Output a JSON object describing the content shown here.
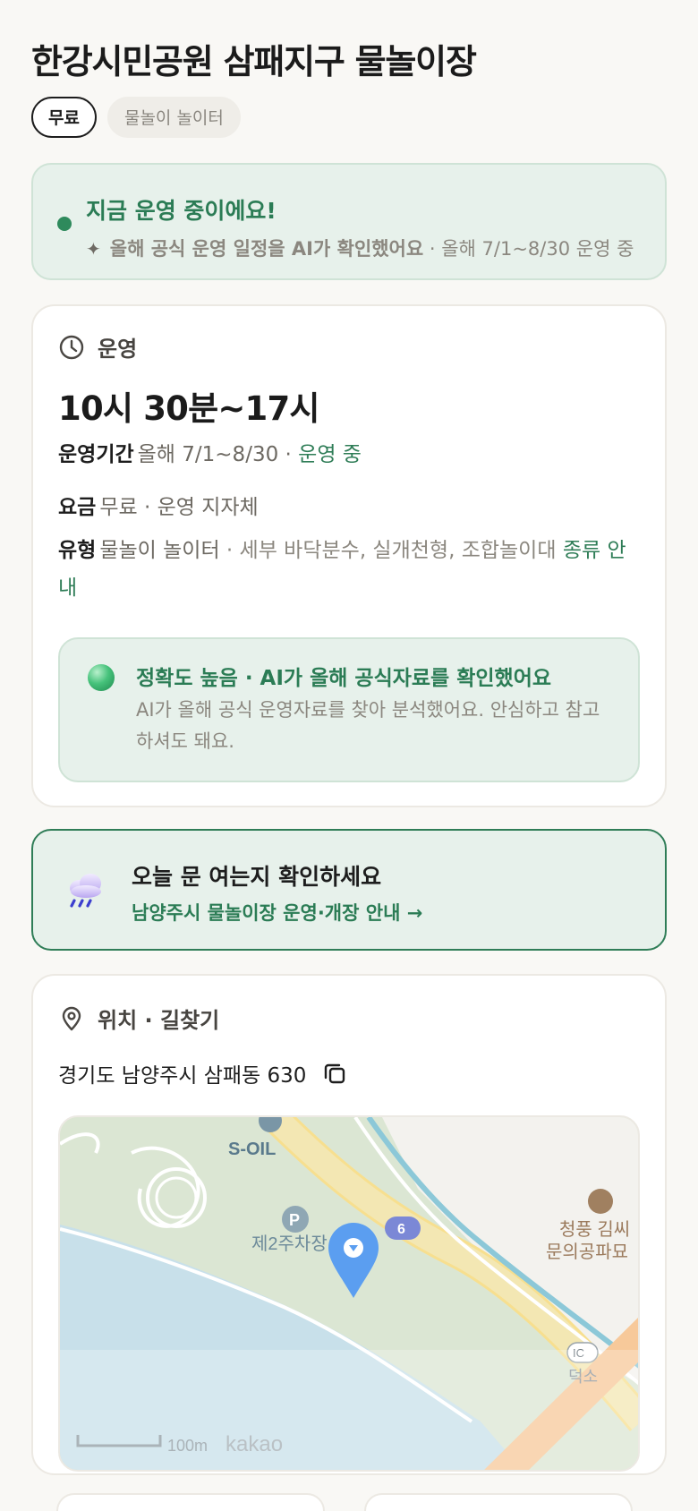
{
  "header": {
    "title": "한강시민공원 삼패지구 물놀이장",
    "chips": {
      "price": "무료",
      "type": "물놀이 놀이터"
    }
  },
  "status": {
    "title": "지금 운영 중이에요!",
    "sub_main": "올해 공식 운영 일정을 AI가 확인했어요",
    "sub_extra": " · 올해 7/1~8/30 운영 중"
  },
  "operation": {
    "section_label": "운영",
    "hours": "10시 30분~17시",
    "period": {
      "key": "운영기간",
      "value": "올해 7/1~8/30 · ",
      "status": "운영 중"
    },
    "fee": {
      "key": "요금",
      "value": "무료 · 운영 지자체"
    },
    "type": {
      "key": "유형",
      "value": "물놀이 놀이터",
      "detail": " · 세부 바닥분수, 실개천형, 조합놀이대 ",
      "link": "종류 안내"
    },
    "ai": {
      "title": "정확도 높음 · AI가 올해 공식자료를 확인했어요",
      "body": "AI가 올해 공식 운영자료를 찾아 분석했어요. 안심하고 참고하셔도 돼요."
    }
  },
  "notice": {
    "title": "오늘 문 여는지 확인하세요",
    "link": "남양주시 물놀이장 운영·개장 안내 →"
  },
  "location": {
    "section_label": "위치 · 길찾기",
    "address": "경기도 남양주시 삼패동 630",
    "map": {
      "labels": {
        "gas": "S-OIL",
        "parking_mark": "P",
        "parking": "제2주차장",
        "route": "6",
        "poi_line1": "청풍 김씨",
        "poi_line2": "문의공파묘",
        "ic_mark": "IC",
        "ic_name": "덕소",
        "scale": "100m",
        "brand": "kakao"
      }
    }
  },
  "colors": {
    "accent": "#2f7d57",
    "accent_bg": "#e7f1eb",
    "text": "#1d1d1d",
    "muted": "#8b877f"
  }
}
